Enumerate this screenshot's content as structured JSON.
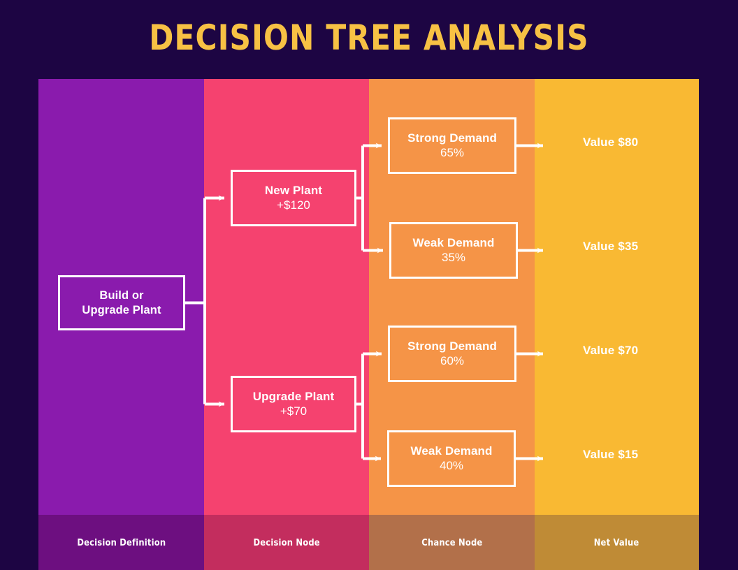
{
  "header": {
    "title": "DECISION TREE ANALYSIS",
    "title_color": "#f7c144",
    "background_color": "#1d0543"
  },
  "columns": [
    {
      "key": "decision_definition",
      "footer_label": "Decision Definition",
      "band_color": "#8a1bad",
      "footer_color": "#6d0f80"
    },
    {
      "key": "decision_node",
      "footer_label": "Decision Node",
      "band_color": "#f5426f",
      "footer_color": "#c32d5e"
    },
    {
      "key": "chance_node",
      "footer_label": "Chance Node",
      "band_color": "#f59447",
      "footer_color": "#b2704a"
    },
    {
      "key": "net_value",
      "footer_label": "Net Value",
      "band_color": "#f9b933",
      "footer_color": "#bf8b36"
    }
  ],
  "chart_data": {
    "type": "diagram",
    "title": "DECISION TREE ANALYSIS",
    "root": {
      "label": "Build or\nUpgrade Plant",
      "label_line1": "Build or",
      "label_line2": "Upgrade Plant",
      "column": "decision_definition"
    },
    "decisions": [
      {
        "label": "New Plant",
        "cost": "+$120",
        "column": "decision_node"
      },
      {
        "label": "Upgrade Plant",
        "cost": "+$70",
        "column": "decision_node"
      }
    ],
    "chance_nodes": [
      {
        "label": "Strong Demand",
        "probability": "65%",
        "probability_value": 65,
        "parent": "New Plant",
        "outcome": "Value $80",
        "outcome_value": 80
      },
      {
        "label": "Weak Demand",
        "probability": "35%",
        "probability_value": 35,
        "parent": "New Plant",
        "outcome": "Value $35",
        "outcome_value": 35
      },
      {
        "label": "Strong Demand",
        "probability": "60%",
        "probability_value": 60,
        "parent": "Upgrade Plant",
        "outcome": "Value $70",
        "outcome_value": 70
      },
      {
        "label": "Weak Demand",
        "probability": "40%",
        "probability_value": 40,
        "parent": "Upgrade Plant",
        "outcome": "Value $15",
        "outcome_value": 15
      }
    ],
    "net_values": [
      "Value $80",
      "Value $35",
      "Value $70",
      "Value $15"
    ]
  }
}
